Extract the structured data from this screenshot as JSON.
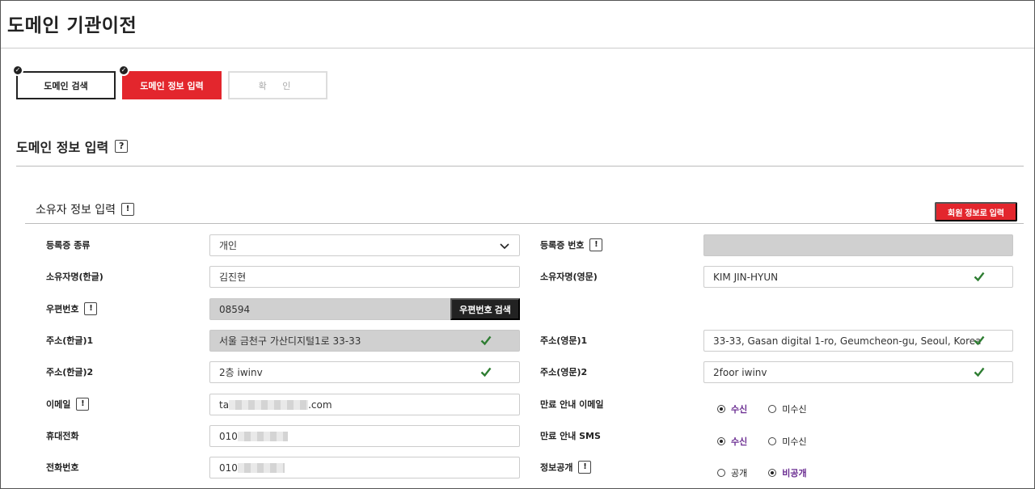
{
  "page": {
    "title": "도메인 기관이전"
  },
  "steps": [
    {
      "label": "도메인 검색"
    },
    {
      "label": "도메인 정보 입력"
    },
    {
      "label": "확 인"
    }
  ],
  "section": {
    "title": "도메인 정보 입력",
    "help": "?"
  },
  "owner": {
    "title": "소유자 정보 입력",
    "info": "!",
    "member_button": "회원 정보로 입력",
    "fields": {
      "reg_type": {
        "label": "등록증 종류",
        "value": "개인"
      },
      "reg_number": {
        "label": "등록증 번호",
        "value": ""
      },
      "name_kr": {
        "label": "소유자명(한글)",
        "value": "김진현"
      },
      "name_en": {
        "label": "소유자명(영문)",
        "value": "KIM JIN-HYUN"
      },
      "zipcode": {
        "label": "우편번호",
        "value": "08594",
        "button": "우편번호 검색"
      },
      "addr_kr1": {
        "label": "주소(한글)1",
        "value": "서울 금천구 가산디지털1로 33-33"
      },
      "addr_en1": {
        "label": "주소(영문)1",
        "value": "33-33, Gasan digital 1-ro, Geumcheon-gu, Seoul, Korea"
      },
      "addr_kr2": {
        "label": "주소(한글)2",
        "value": "2층 iwinv"
      },
      "addr_en2": {
        "label": "주소(영문)2",
        "value": "2foor iwinv"
      },
      "email": {
        "label": "이메일",
        "value_start": "ta",
        "value_end": ".com"
      },
      "mobile": {
        "label": "휴대전화",
        "value_start": "010"
      },
      "phone": {
        "label": "전화번호",
        "value_start": "010"
      },
      "expiry_email": {
        "label": "만료 안내 이메일",
        "options": [
          "수신",
          "미수신"
        ],
        "selected": "수신"
      },
      "expiry_sms": {
        "label": "만료 안내 SMS",
        "options": [
          "수신",
          "미수신"
        ],
        "selected": "수신"
      },
      "disclosure": {
        "label": "정보공개",
        "options": [
          "공개",
          "비공개"
        ],
        "selected": "비공개"
      }
    }
  },
  "icons": {
    "check": "check-icon",
    "chevron": "chevron-down-icon",
    "step_done": "check-circle-icon"
  },
  "colors": {
    "accent": "#e3262d",
    "check": "#2e7d32",
    "selected_text": "#6a2c91"
  }
}
